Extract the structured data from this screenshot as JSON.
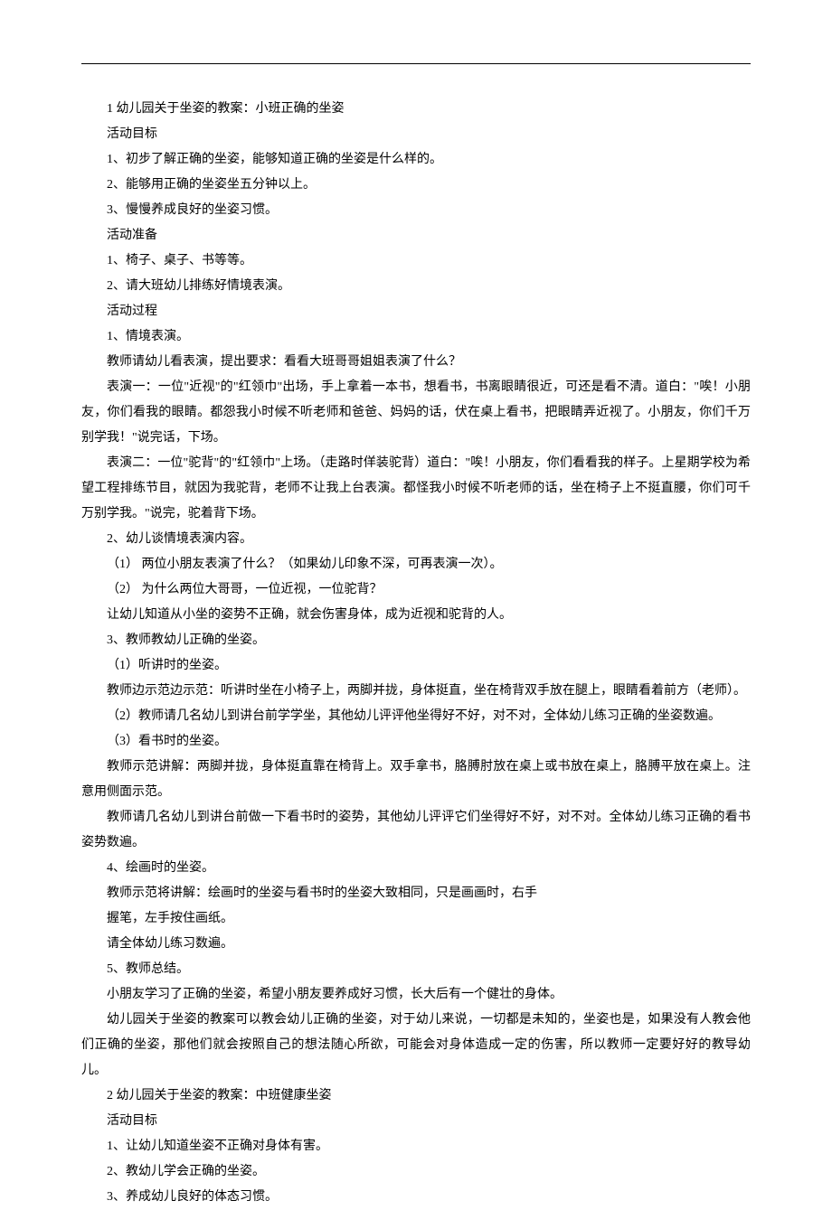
{
  "lines": [
    "1 幼儿园关于坐姿的教案：小班正确的坐姿",
    "活动目标",
    "1、初步了解正确的坐姿，能够知道正确的坐姿是什么样的。",
    "2、能够用正确的坐姿坐五分钟以上。",
    "3、慢慢养成良好的坐姿习惯。",
    "活动准备",
    "1、椅子、桌子、书等等。",
    "2、请大班幼儿排练好情境表演。",
    "活动过程",
    "1、情境表演。",
    "教师请幼儿看表演，提出要求：看看大班哥哥姐姐表演了什么？"
  ],
  "b1": "表演一：一位\"近视\"的\"红领巾\"出场，手上拿着一本书，想看书，书离眼睛很近，可还是看不清。道白：\"唉！小朋友，你们看我的眼睛。都怨我小时候不听老师和爸爸、妈妈的话，伏在桌上看书，把眼睛弄近视了。小朋友，你们千万别学我！\"说完话，下场。",
  "b2": "表演二：一位\"驼背\"的\"红领巾\"上场。（走路时佯装驼背）道白：\"唉！小朋友，你们看看我的样子。上星期学校为希望工程排练节目，就因为我驼背，老师不让我上台表演。都怪我小时候不听老师的话，坐在椅子上不挺直腰，你们可千万别学我。\"说完，驼着背下场。",
  "lines2": [
    "2、幼儿谈情境表演内容。",
    "（1） 两位小朋友表演了什么？（如果幼儿印象不深，可再表演一次）。",
    "（2） 为什么两位大哥哥，一位近视，一位驼背？",
    "让幼儿知道从小坐的姿势不正确，就会伤害身体，成为近视和驼背的人。",
    "3、教师教幼儿正确的坐姿。",
    "（1）听讲时的坐姿。"
  ],
  "b3": "教师边示范边示范：听讲时坐在小椅子上，两脚并拢，身体挺直，坐在椅背双手放在腿上，眼睛看着前方（老师）。",
  "lines3": [
    "（2）教师请几名幼儿到讲台前学学坐，其他幼儿评评他坐得好不好，对不对，全体幼儿练习正确的坐姿数遍。",
    "（3）看书时的坐姿。"
  ],
  "b4": "教师示范讲解：两脚并拢，身体挺直靠在椅背上。双手拿书，胳膊肘放在桌上或书放在桌上，胳膊平放在桌上。注意用侧面示范。",
  "b5": "教师请几名幼儿到讲台前做一下看书时的姿势，其他幼儿评评它们坐得好不好，对不对。全体幼儿练习正确的看书姿势数遍。",
  "lines4": [
    "4、绘画时的坐姿。",
    "教师示范将讲解：绘画时的坐姿与看书时的坐姿大致相同，只是画画时，右手",
    "握笔，左手按住画纸。",
    "请全体幼儿练习数遍。",
    "5、教师总结。",
    "小朋友学习了正确的坐姿，希望小朋友要养成好习惯，长大后有一个健壮的身体。"
  ],
  "b6": "幼儿园关于坐姿的教案可以教会幼儿正确的坐姿，对于幼儿来说，一切都是未知的，坐姿也是，如果没有人教会他们正确的坐姿，那他们就会按照自己的想法随心所欲，可能会对身体造成一定的伤害，所以教师一定要好好的教导幼儿。",
  "lines5": [
    "2 幼儿园关于坐姿的教案：中班健康坐姿",
    "活动目标",
    "1、让幼儿知道坐姿不正确对身体有害。",
    "2、教幼儿学会正确的坐姿。",
    "3、养成幼儿良好的体态习惯。"
  ]
}
